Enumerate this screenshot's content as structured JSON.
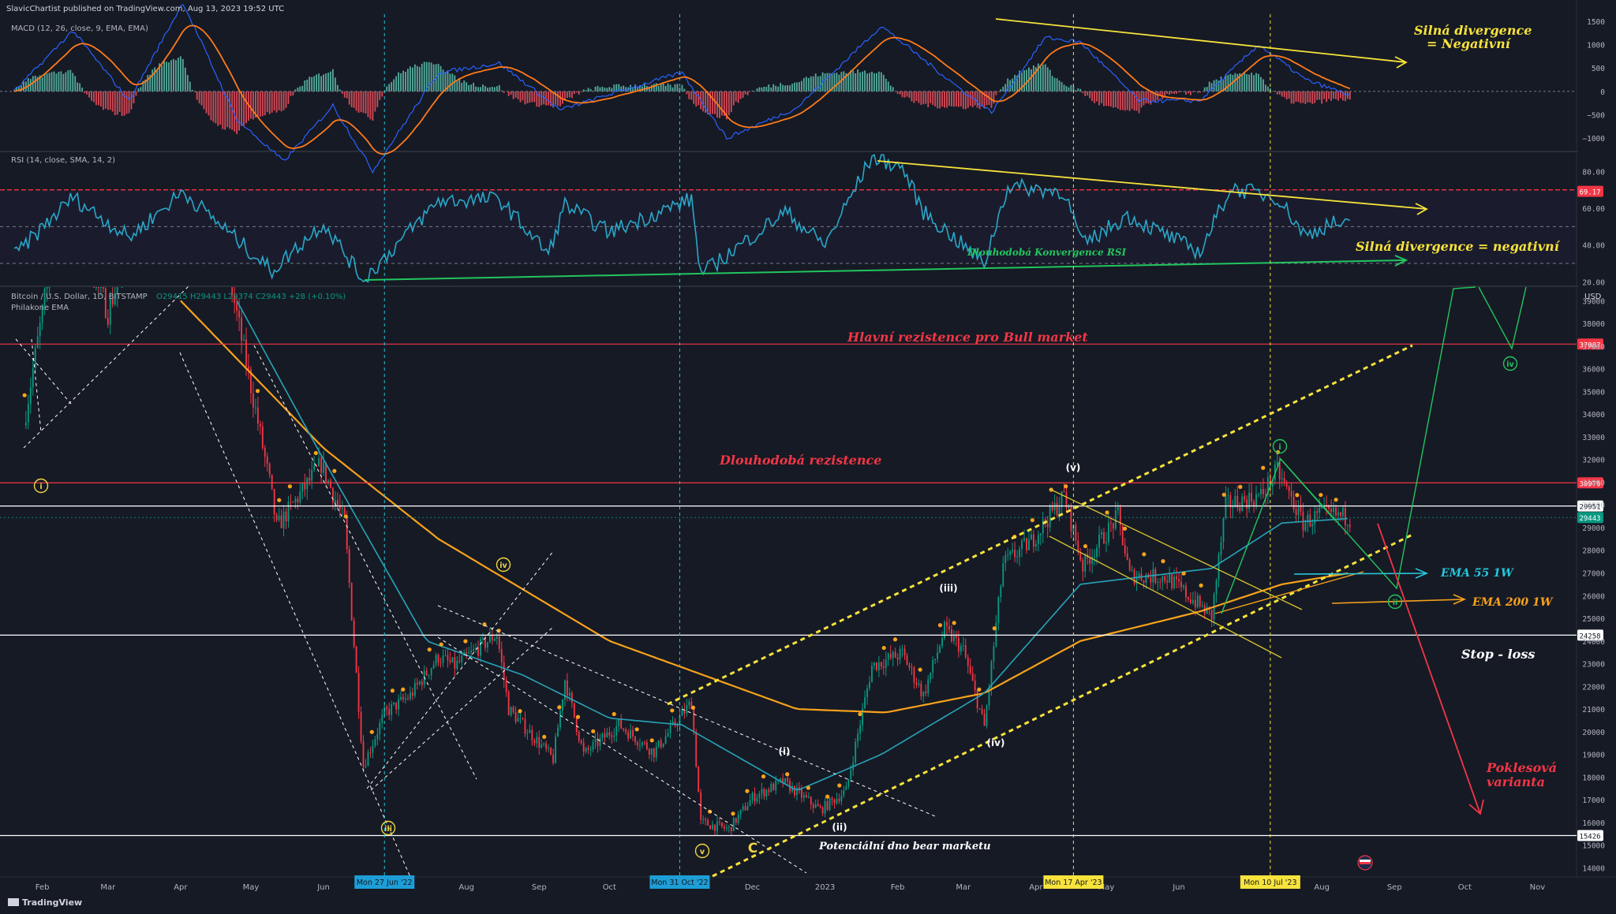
{
  "header": {
    "published": "SlavicChartist published on TradingView.com, Aug 13, 2023 19:52 UTC",
    "footer_logo": "TradingView"
  },
  "panes": {
    "macd": {
      "label": "MACD (12, 26, close, 9, EMA, EMA)",
      "ticks": [
        1500,
        1000,
        500,
        0,
        -500,
        -1000
      ],
      "tick_labels": [
        "1500",
        "1000",
        "500",
        "0",
        "−500",
        "−1000"
      ],
      "range": [
        -1250,
        1650
      ]
    },
    "rsi": {
      "label": "RSI (14, close, SMA, 14, 2)",
      "ticks": [
        80,
        60,
        40,
        20
      ],
      "tick_labels": [
        "80.00",
        "60.00",
        "40.00",
        "20.00"
      ],
      "range": [
        18,
        90
      ],
      "badge": "69.17",
      "bands": [
        70,
        50,
        30
      ]
    },
    "price": {
      "label": "Bitcoin / U.S. Dollar, 1D, BITSTAMP",
      "label_values": "O29415 H29443 L29374 C29443 +28 (+0.10%)",
      "indicator": "Philakone EMA",
      "currency": "USD",
      "ticks": [
        39000,
        38000,
        37000,
        36000,
        35000,
        34000,
        33000,
        32000,
        31000,
        30000,
        29000,
        28000,
        27000,
        26000,
        25000,
        24000,
        23000,
        22000,
        21000,
        20000,
        19000,
        18000,
        17000,
        16000,
        15000,
        14000
      ],
      "range": [
        13600,
        39600
      ],
      "levels": [
        {
          "label": "37087",
          "value": 37087,
          "color": "#f23645"
        },
        {
          "label": "30970",
          "value": 30970,
          "color": "#f23645"
        },
        {
          "label": "29951",
          "value": 29951,
          "color": "#ffffff"
        },
        {
          "label": "29443",
          "value": 29443,
          "color": "#089981"
        },
        {
          "label": "24258",
          "value": 24258,
          "color": "#ffffff"
        },
        {
          "label": "15426",
          "value": 15426,
          "color": "#ffffff"
        }
      ]
    }
  },
  "time_axis": {
    "labels": [
      "Feb",
      "Mar",
      "Apr",
      "May",
      "Jun",
      "Aug",
      "Sep",
      "Oct",
      "Dec",
      "2023",
      "Feb",
      "Mar",
      "Apr",
      "May",
      "Jun",
      "Aug",
      "Sep",
      "Oct",
      "Nov"
    ],
    "highlights": [
      {
        "label": "Mon 27 Jun '22",
        "color": "#1e9ed6"
      },
      {
        "label": "Mon 31 Oct '22",
        "color": "#1e9ed6"
      },
      {
        "label": "Mon 17 Apr '23",
        "color": "#f7e33b"
      },
      {
        "label": "Mon 10 Jul '23",
        "color": "#f7e33b"
      }
    ]
  },
  "annotations": {
    "macd_divergence_1": "Silná divergence",
    "macd_divergence_2": "= Negativní",
    "rsi_convergence": "Dlouhodobá Konvergence RSI",
    "rsi_divergence": "Silná divergence = negativní",
    "bull_resistance": "Hlavní rezistence pro Bull market",
    "long_resistance": "Dlouhodobá rezistence",
    "ema55": "EMA 55 1W",
    "ema200": "EMA 200 1W",
    "stop_loss": "Stop - loss",
    "bear_bottom": "Potenciální dno bear marketu",
    "bearish_1": "Poklesová",
    "bearish_2": "varianta"
  },
  "waves": [
    {
      "label": "i",
      "kind": "circle",
      "color": "#f0d541"
    },
    {
      "label": "iii",
      "kind": "circle",
      "color": "#f0d541"
    },
    {
      "label": "iv",
      "kind": "circle",
      "color": "#f0d541"
    },
    {
      "label": "v",
      "kind": "circle",
      "color": "#f0d541"
    },
    {
      "label": "C",
      "kind": "letter",
      "color": "#f0d541"
    },
    {
      "label": "(i)",
      "kind": "paren",
      "color": "#ffffff"
    },
    {
      "label": "(ii)",
      "kind": "paren",
      "color": "#ffffff"
    },
    {
      "label": "(iii)",
      "kind": "paren",
      "color": "#ffffff"
    },
    {
      "label": "(iv)",
      "kind": "paren",
      "color": "#ffffff"
    },
    {
      "label": "(v)",
      "kind": "paren",
      "color": "#ffffff"
    },
    {
      "label": "i",
      "kind": "circle",
      "color": "#22c55e"
    },
    {
      "label": "ii",
      "kind": "circle",
      "color": "#22c55e"
    },
    {
      "label": "iv",
      "kind": "circle",
      "color": "#22c55e"
    }
  ],
  "colors": {
    "background": "#161a25",
    "up": "#089981",
    "down": "#f23645",
    "ema55": "#26a4b8",
    "ema200": "#f7a21b",
    "macd_line": "#2962ff",
    "signal_line": "#ff7a1a",
    "rsi_line": "#2aa7c9",
    "trend_yellow": "#f7e33b",
    "trend_green": "#22c55e"
  },
  "chart_data": {
    "type": "candlestick",
    "symbol": "Bitcoin / U.S. Dollar",
    "interval": "1D",
    "x_range": [
      "2022-01-20",
      "2023-11-15"
    ],
    "y_range": [
      14000,
      39000
    ],
    "anchors": [
      [
        "2022-01-24",
        33500
      ],
      [
        "2022-02-10",
        44000
      ],
      [
        "2022-03-01",
        38500
      ],
      [
        "2022-03-28",
        47000
      ],
      [
        "2022-04-20",
        41000
      ],
      [
        "2022-05-09",
        31000
      ],
      [
        "2022-05-12",
        29000
      ],
      [
        "2022-05-31",
        31800
      ],
      [
        "2022-06-10",
        29200
      ],
      [
        "2022-06-18",
        18500
      ],
      [
        "2022-06-27",
        20800
      ],
      [
        "2022-07-08",
        21600
      ],
      [
        "2022-07-20",
        23300
      ],
      [
        "2022-07-27",
        22900
      ],
      [
        "2022-08-14",
        24300
      ],
      [
        "2022-08-19",
        21000
      ],
      [
        "2022-09-07",
        18800
      ],
      [
        "2022-09-12",
        22300
      ],
      [
        "2022-09-20",
        19000
      ],
      [
        "2022-10-05",
        20300
      ],
      [
        "2022-10-20",
        19100
      ],
      [
        "2022-11-05",
        21300
      ],
      [
        "2022-11-09",
        16000
      ],
      [
        "2022-11-21",
        15700
      ],
      [
        "2022-12-01",
        17100
      ],
      [
        "2022-12-14",
        17800
      ],
      [
        "2022-12-30",
        16550
      ],
      [
        "2023-01-10",
        17400
      ],
      [
        "2023-01-21",
        22900
      ],
      [
        "2023-02-03",
        23450
      ],
      [
        "2023-02-12",
        21600
      ],
      [
        "2023-02-21",
        24500
      ],
      [
        "2023-03-01",
        23600
      ],
      [
        "2023-03-10",
        20200
      ],
      [
        "2023-03-18",
        27400
      ],
      [
        "2023-03-30",
        28400
      ],
      [
        "2023-04-13",
        30400
      ],
      [
        "2023-04-21",
        27300
      ],
      [
        "2023-05-06",
        29500
      ],
      [
        "2023-05-11",
        26900
      ],
      [
        "2023-05-27",
        26800
      ],
      [
        "2023-06-15",
        25100
      ],
      [
        "2023-06-21",
        30000
      ],
      [
        "2023-07-06",
        30400
      ],
      [
        "2023-07-13",
        31500
      ],
      [
        "2023-07-24",
        29200
      ],
      [
        "2023-08-01",
        29600
      ],
      [
        "2023-08-13",
        29443
      ]
    ],
    "ema55_1w": [
      [
        "2022-06-01",
        39000
      ],
      [
        "2022-06-27",
        30000
      ],
      [
        "2022-08-15",
        26500
      ],
      [
        "2022-09-10",
        24700
      ],
      [
        "2022-11-01",
        22800
      ],
      [
        "2022-12-10",
        21000
      ],
      [
        "2023-01-15",
        20800
      ],
      [
        "2023-02-20",
        21700
      ],
      [
        "2023-04-15",
        24000
      ],
      [
        "2023-06-15",
        25600
      ],
      [
        "2023-07-20",
        26500
      ],
      [
        "2023-08-13",
        27000
      ]
    ],
    "ema200_1d": [
      [
        "2022-04-01",
        39000
      ],
      [
        "2022-06-01",
        32500
      ],
      [
        "2022-07-20",
        28500
      ],
      [
        "2022-10-01",
        24000
      ],
      [
        "2022-12-20",
        21000
      ],
      [
        "2023-01-27",
        20850
      ],
      [
        "2023-03-10",
        21700
      ],
      [
        "2023-04-20",
        24000
      ],
      [
        "2023-06-10",
        25300
      ],
      [
        "2023-07-15",
        26500
      ],
      [
        "2023-08-13",
        27000
      ]
    ],
    "ema55_1d": [
      [
        "2022-04-25",
        39000
      ],
      [
        "2022-06-01",
        32000
      ],
      [
        "2022-07-15",
        24000
      ],
      [
        "2022-08-25",
        22500
      ],
      [
        "2022-10-01",
        20600
      ],
      [
        "2022-11-01",
        20300
      ],
      [
        "2022-12-20",
        17400
      ],
      [
        "2023-01-25",
        19000
      ],
      [
        "2023-03-10",
        21700
      ],
      [
        "2023-04-20",
        26500
      ],
      [
        "2023-06-15",
        27200
      ],
      [
        "2023-07-15",
        29200
      ],
      [
        "2023-08-13",
        29400
      ]
    ],
    "macd_anchors": [
      [
        "2022-01-20",
        0
      ],
      [
        "2022-02-14",
        1300
      ],
      [
        "2022-03-10",
        -200
      ],
      [
        "2022-04-02",
        1900
      ],
      [
        "2022-04-25",
        -600
      ],
      [
        "2022-05-15",
        -1500
      ],
      [
        "2022-06-05",
        -300
      ],
      [
        "2022-06-22",
        -1700
      ],
      [
        "2022-07-20",
        400
      ],
      [
        "2022-08-15",
        600
      ],
      [
        "2022-09-10",
        -400
      ],
      [
        "2022-10-05",
        0
      ],
      [
        "2022-11-01",
        400
      ],
      [
        "2022-11-20",
        -1000
      ],
      [
        "2022-12-20",
        -350
      ],
      [
        "2023-01-25",
        1400
      ],
      [
        "2023-03-01",
        0
      ],
      [
        "2023-03-13",
        -450
      ],
      [
        "2023-04-05",
        1150
      ],
      [
        "2023-04-20",
        1050
      ],
      [
        "2023-05-15",
        -200
      ],
      [
        "2023-06-10",
        -200
      ],
      [
        "2023-07-05",
        1000
      ],
      [
        "2023-07-25",
        250
      ],
      [
        "2023-08-13",
        -80
      ]
    ],
    "rsi_anchors": [
      [
        "2022-01-20",
        34
      ],
      [
        "2022-02-14",
        66
      ],
      [
        "2022-03-10",
        44
      ],
      [
        "2022-04-02",
        69
      ],
      [
        "2022-04-25",
        43
      ],
      [
        "2022-05-10",
        26
      ],
      [
        "2022-06-01",
        52
      ],
      [
        "2022-06-18",
        21
      ],
      [
        "2022-07-20",
        64
      ],
      [
        "2022-08-15",
        65
      ],
      [
        "2022-09-05",
        35
      ],
      [
        "2022-09-12",
        62
      ],
      [
        "2022-10-01",
        47
      ],
      [
        "2022-11-05",
        65
      ],
      [
        "2022-11-09",
        24
      ],
      [
        "2022-12-15",
        58
      ],
      [
        "2023-01-01",
        40
      ],
      [
        "2023-01-21",
        88
      ],
      [
        "2023-02-03",
        82
      ],
      [
        "2023-02-12",
        58
      ],
      [
        "2023-03-10",
        30
      ],
      [
        "2023-03-20",
        72
      ],
      [
        "2023-04-13",
        69
      ],
      [
        "2023-04-21",
        40
      ],
      [
        "2023-05-10",
        56
      ],
      [
        "2023-06-10",
        36
      ],
      [
        "2023-06-23",
        71
      ],
      [
        "2023-07-13",
        66
      ],
      [
        "2023-07-25",
        45
      ],
      [
        "2023-08-05",
        52
      ],
      [
        "2023-08-13",
        50
      ]
    ]
  }
}
